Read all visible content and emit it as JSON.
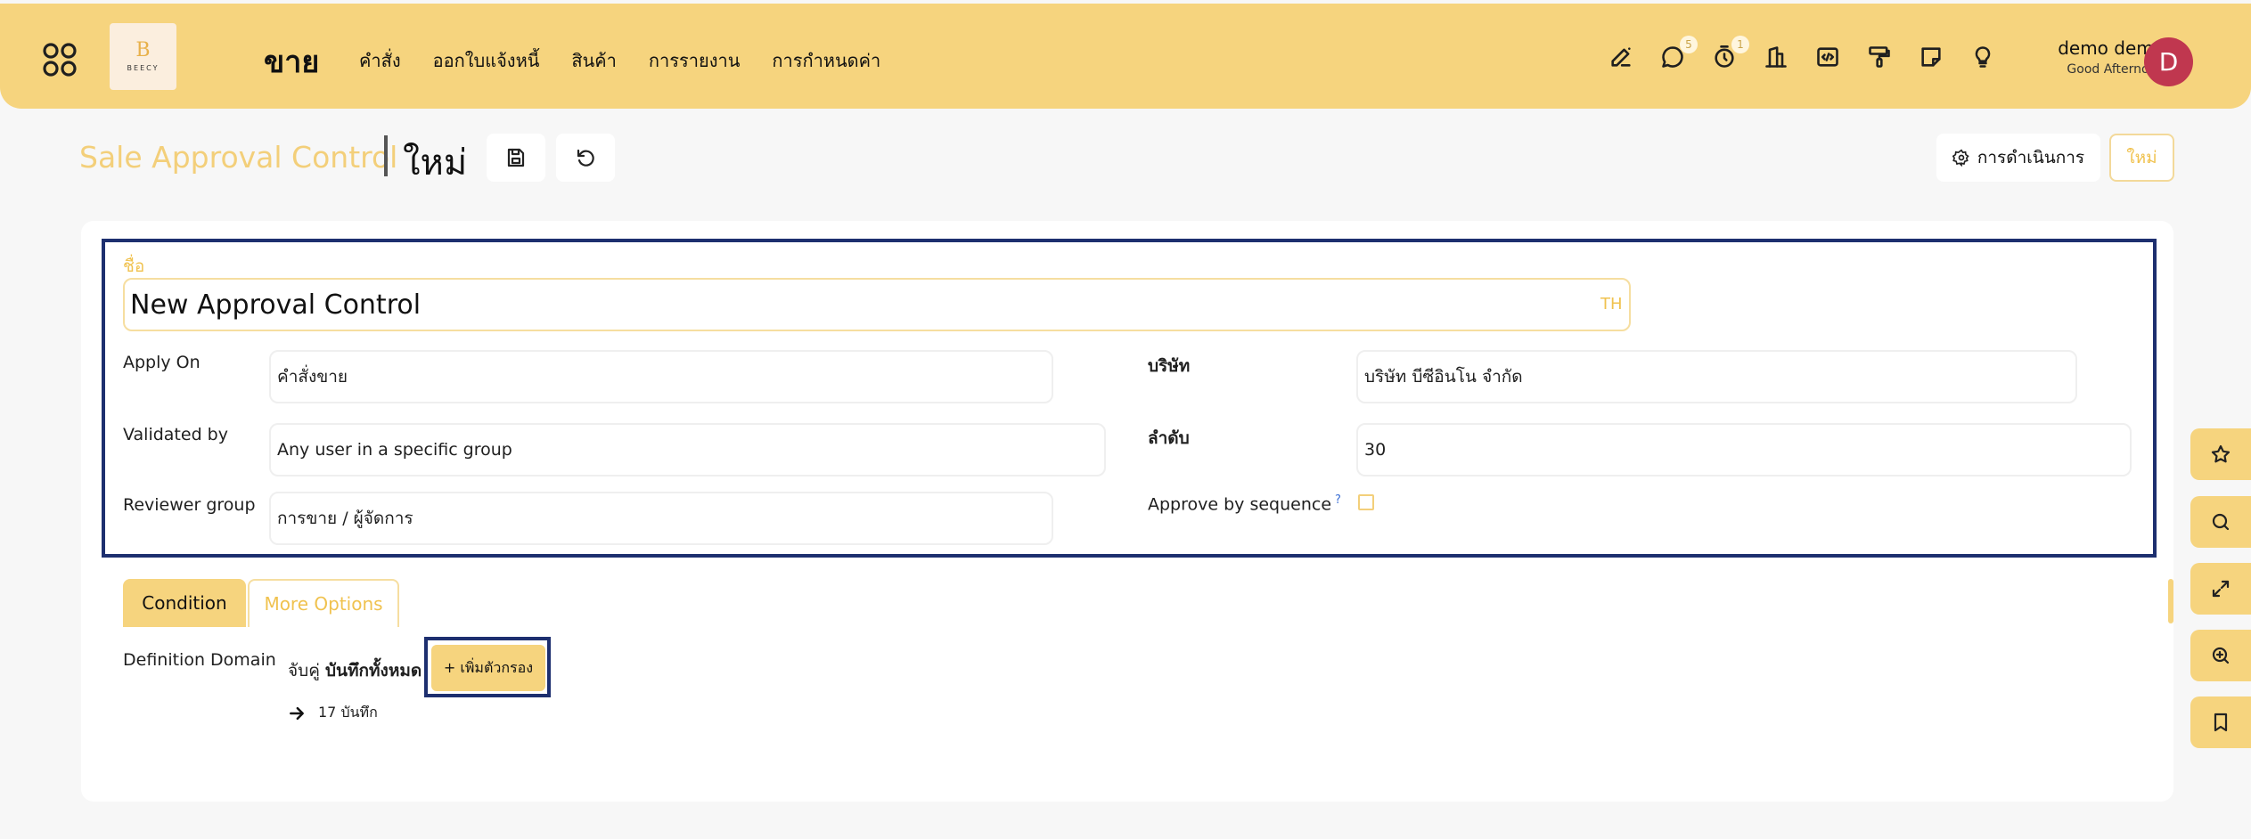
{
  "navbar": {
    "brand": "ขาย",
    "menu": [
      "คำสั่ง",
      "ออกใบแจ้งหนี้",
      "สินค้า",
      "การรายงาน",
      "การกำหนดค่า"
    ],
    "messages_badge": "5",
    "activities_badge": "1",
    "user_name": "demo demo",
    "greeting": "Good Afternoon",
    "avatar_letter": "D",
    "logo_letter": "B",
    "logo_text": "BEECY"
  },
  "breadcrumb": {
    "parent": "Sale Approval Control",
    "current": "ใหม่"
  },
  "actions": {
    "action_label": "การดำเนินการ",
    "new_label": "ใหม่"
  },
  "form": {
    "name_label": "ชื่อ",
    "name_value": "New Approval Control",
    "lang": "TH",
    "apply_on_label": "Apply On",
    "apply_on_value": "คำสั่งขาย",
    "validated_by_label": "Validated by",
    "validated_by_value": "Any user in a specific group",
    "reviewer_group_label": "Reviewer group",
    "reviewer_group_value": "การขาย / ผู้จัดการ",
    "company_label": "บริษัท",
    "company_value": "บริษัท บีซีอินโน จำกัด",
    "sequence_label": "ลำดับ",
    "sequence_value": "30",
    "approve_seq_label": "Approve by sequence",
    "help_mark": "?",
    "approve_seq_checked": false
  },
  "tabs": {
    "condition": "Condition",
    "more_options": "More Options"
  },
  "domain": {
    "label": "Definition Domain",
    "match_prefix": "จับคู่ ",
    "match_bold": "บันทึกทั้งหมด",
    "add_filter": "+ เพิ่มตัวกรอง",
    "records": "17 บันทึก"
  },
  "colors": {
    "accent": "#f6d47e",
    "accent_text": "#f0c24f",
    "highlight_border": "#1d2f6f",
    "avatar_bg": "#c0374f"
  }
}
